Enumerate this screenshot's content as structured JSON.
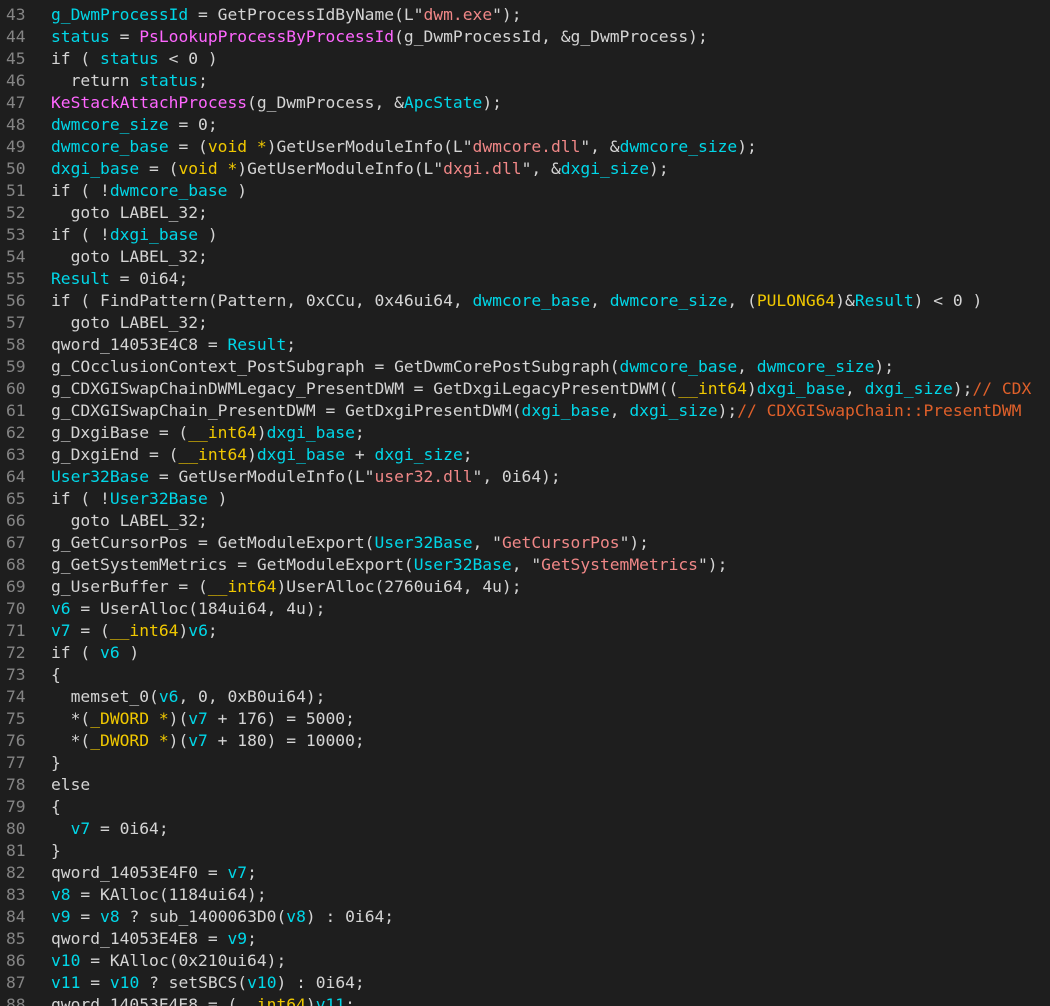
{
  "colors": {
    "background": "#1e1e1e",
    "line_number": "#858585",
    "text": "#d4d4d4",
    "variable": "#00d7e8",
    "string": "#f08787",
    "kernel_function": "#ff66ff",
    "type": "#f0c800",
    "comment": "#e0602a"
  },
  "lines": [
    {
      "n": "43",
      "tokens": [
        [
          "var",
          "g_DwmProcessId"
        ],
        [
          "text",
          " = GetProcessIdByName(L\""
        ],
        [
          "str",
          "dwm.exe"
        ],
        [
          "text",
          "\");"
        ]
      ]
    },
    {
      "n": "44",
      "tokens": [
        [
          "var",
          "status"
        ],
        [
          "text",
          " = "
        ],
        [
          "kfun",
          "PsLookupProcessByProcessId"
        ],
        [
          "text",
          "(g_DwmProcessId, &g_DwmProcess);"
        ]
      ]
    },
    {
      "n": "45",
      "tokens": [
        [
          "text",
          "if ( "
        ],
        [
          "var",
          "status"
        ],
        [
          "text",
          " < 0 )"
        ]
      ]
    },
    {
      "n": "46",
      "tokens": [
        [
          "text",
          "  return "
        ],
        [
          "var",
          "status"
        ],
        [
          "text",
          ";"
        ]
      ]
    },
    {
      "n": "47",
      "tokens": [
        [
          "kfun",
          "KeStackAttachProcess"
        ],
        [
          "text",
          "(g_DwmProcess, &"
        ],
        [
          "var",
          "ApcState"
        ],
        [
          "text",
          ");"
        ]
      ]
    },
    {
      "n": "48",
      "tokens": [
        [
          "var",
          "dwmcore_size"
        ],
        [
          "text",
          " = 0;"
        ]
      ]
    },
    {
      "n": "49",
      "tokens": [
        [
          "var",
          "dwmcore_base"
        ],
        [
          "text",
          " = ("
        ],
        [
          "type",
          "void *"
        ],
        [
          "text",
          ")GetUserModuleInfo(L\""
        ],
        [
          "str",
          "dwmcore.dll"
        ],
        [
          "text",
          "\", &"
        ],
        [
          "var",
          "dwmcore_size"
        ],
        [
          "text",
          ");"
        ]
      ]
    },
    {
      "n": "50",
      "tokens": [
        [
          "var",
          "dxgi_base"
        ],
        [
          "text",
          " = ("
        ],
        [
          "type",
          "void *"
        ],
        [
          "text",
          ")GetUserModuleInfo(L\""
        ],
        [
          "str",
          "dxgi.dll"
        ],
        [
          "text",
          "\", &"
        ],
        [
          "var",
          "dxgi_size"
        ],
        [
          "text",
          ");"
        ]
      ]
    },
    {
      "n": "51",
      "tokens": [
        [
          "text",
          "if ( !"
        ],
        [
          "var",
          "dwmcore_base"
        ],
        [
          "text",
          " )"
        ]
      ]
    },
    {
      "n": "52",
      "tokens": [
        [
          "text",
          "  goto LABEL_32;"
        ]
      ]
    },
    {
      "n": "53",
      "tokens": [
        [
          "text",
          "if ( !"
        ],
        [
          "var",
          "dxgi_base"
        ],
        [
          "text",
          " )"
        ]
      ]
    },
    {
      "n": "54",
      "tokens": [
        [
          "text",
          "  goto LABEL_32;"
        ]
      ]
    },
    {
      "n": "55",
      "tokens": [
        [
          "var",
          "Result"
        ],
        [
          "text",
          " = 0i64;"
        ]
      ]
    },
    {
      "n": "56",
      "tokens": [
        [
          "text",
          "if ( FindPattern(Pattern, 0xCCu, 0x46ui64, "
        ],
        [
          "var",
          "dwmcore_base"
        ],
        [
          "text",
          ", "
        ],
        [
          "var",
          "dwmcore_size"
        ],
        [
          "text",
          ", ("
        ],
        [
          "type",
          "PULONG64"
        ],
        [
          "text",
          ")&"
        ],
        [
          "var",
          "Result"
        ],
        [
          "text",
          ") < 0 )"
        ]
      ]
    },
    {
      "n": "57",
      "tokens": [
        [
          "text",
          "  goto LABEL_32;"
        ]
      ]
    },
    {
      "n": "58",
      "tokens": [
        [
          "text",
          "qword_14053E4C8 = "
        ],
        [
          "var",
          "Result"
        ],
        [
          "text",
          ";"
        ]
      ]
    },
    {
      "n": "59",
      "tokens": [
        [
          "text",
          "g_COcclusionContext_PostSubgraph = GetDwmCorePostSubgraph("
        ],
        [
          "var",
          "dwmcore_base"
        ],
        [
          "text",
          ", "
        ],
        [
          "var",
          "dwmcore_size"
        ],
        [
          "text",
          ");"
        ]
      ]
    },
    {
      "n": "60",
      "tokens": [
        [
          "text",
          "g_CDXGISwapChainDWMLegacy_PresentDWM = GetDxgiLegacyPresentDWM(("
        ],
        [
          "type",
          "__int64"
        ],
        [
          "text",
          ")"
        ],
        [
          "var",
          "dxgi_base"
        ],
        [
          "text",
          ", "
        ],
        [
          "var",
          "dxgi_size"
        ],
        [
          "text",
          ");"
        ],
        [
          "cmt",
          "// CDX"
        ]
      ]
    },
    {
      "n": "61",
      "tokens": [
        [
          "text",
          "g_CDXGISwapChain_PresentDWM = GetDxgiPresentDWM("
        ],
        [
          "var",
          "dxgi_base"
        ],
        [
          "text",
          ", "
        ],
        [
          "var",
          "dxgi_size"
        ],
        [
          "text",
          ");"
        ],
        [
          "cmt",
          "// CDXGISwapChain::PresentDWM"
        ]
      ]
    },
    {
      "n": "62",
      "tokens": [
        [
          "text",
          "g_DxgiBase = ("
        ],
        [
          "type",
          "__int64"
        ],
        [
          "text",
          ")"
        ],
        [
          "var",
          "dxgi_base"
        ],
        [
          "text",
          ";"
        ]
      ]
    },
    {
      "n": "63",
      "tokens": [
        [
          "text",
          "g_DxgiEnd = ("
        ],
        [
          "type",
          "__int64"
        ],
        [
          "text",
          ")"
        ],
        [
          "var",
          "dxgi_base"
        ],
        [
          "text",
          " + "
        ],
        [
          "var",
          "dxgi_size"
        ],
        [
          "text",
          ";"
        ]
      ]
    },
    {
      "n": "64",
      "tokens": [
        [
          "var",
          "User32Base"
        ],
        [
          "text",
          " = GetUserModuleInfo(L\""
        ],
        [
          "str",
          "user32.dll"
        ],
        [
          "text",
          "\", 0i64);"
        ]
      ]
    },
    {
      "n": "65",
      "tokens": [
        [
          "text",
          "if ( !"
        ],
        [
          "var",
          "User32Base"
        ],
        [
          "text",
          " )"
        ]
      ]
    },
    {
      "n": "66",
      "tokens": [
        [
          "text",
          "  goto LABEL_32;"
        ]
      ]
    },
    {
      "n": "67",
      "tokens": [
        [
          "text",
          "g_GetCursorPos = GetModuleExport("
        ],
        [
          "var",
          "User32Base"
        ],
        [
          "text",
          ", \""
        ],
        [
          "str",
          "GetCursorPos"
        ],
        [
          "text",
          "\");"
        ]
      ]
    },
    {
      "n": "68",
      "tokens": [
        [
          "text",
          "g_GetSystemMetrics = GetModuleExport("
        ],
        [
          "var",
          "User32Base"
        ],
        [
          "text",
          ", \""
        ],
        [
          "str",
          "GetSystemMetrics"
        ],
        [
          "text",
          "\");"
        ]
      ]
    },
    {
      "n": "69",
      "tokens": [
        [
          "text",
          "g_UserBuffer = ("
        ],
        [
          "type",
          "__int64"
        ],
        [
          "text",
          ")UserAlloc(2760ui64, 4u);"
        ]
      ]
    },
    {
      "n": "70",
      "tokens": [
        [
          "var",
          "v6"
        ],
        [
          "text",
          " = UserAlloc(184ui64, 4u);"
        ]
      ]
    },
    {
      "n": "71",
      "tokens": [
        [
          "var",
          "v7"
        ],
        [
          "text",
          " = ("
        ],
        [
          "type",
          "__int64"
        ],
        [
          "text",
          ")"
        ],
        [
          "var",
          "v6"
        ],
        [
          "text",
          ";"
        ]
      ]
    },
    {
      "n": "72",
      "tokens": [
        [
          "text",
          "if ( "
        ],
        [
          "var",
          "v6"
        ],
        [
          "text",
          " )"
        ]
      ]
    },
    {
      "n": "73",
      "tokens": [
        [
          "text",
          "{"
        ]
      ]
    },
    {
      "n": "74",
      "tokens": [
        [
          "text",
          "  memset_0("
        ],
        [
          "var",
          "v6"
        ],
        [
          "text",
          ", 0, 0xB0ui64);"
        ]
      ]
    },
    {
      "n": "75",
      "tokens": [
        [
          "text",
          "  *("
        ],
        [
          "type",
          "_DWORD *"
        ],
        [
          "text",
          ")("
        ],
        [
          "var",
          "v7"
        ],
        [
          "text",
          " + 176) = 5000;"
        ]
      ]
    },
    {
      "n": "76",
      "tokens": [
        [
          "text",
          "  *("
        ],
        [
          "type",
          "_DWORD *"
        ],
        [
          "text",
          ")("
        ],
        [
          "var",
          "v7"
        ],
        [
          "text",
          " + 180) = 10000;"
        ]
      ]
    },
    {
      "n": "77",
      "tokens": [
        [
          "text",
          "}"
        ]
      ]
    },
    {
      "n": "78",
      "tokens": [
        [
          "text",
          "else"
        ]
      ]
    },
    {
      "n": "79",
      "tokens": [
        [
          "text",
          "{"
        ]
      ]
    },
    {
      "n": "80",
      "tokens": [
        [
          "text",
          "  "
        ],
        [
          "var",
          "v7"
        ],
        [
          "text",
          " = 0i64;"
        ]
      ]
    },
    {
      "n": "81",
      "tokens": [
        [
          "text",
          "}"
        ]
      ]
    },
    {
      "n": "82",
      "tokens": [
        [
          "text",
          "qword_14053E4F0 = "
        ],
        [
          "var",
          "v7"
        ],
        [
          "text",
          ";"
        ]
      ]
    },
    {
      "n": "83",
      "tokens": [
        [
          "var",
          "v8"
        ],
        [
          "text",
          " = KAlloc(1184ui64);"
        ]
      ]
    },
    {
      "n": "84",
      "tokens": [
        [
          "var",
          "v9"
        ],
        [
          "text",
          " = "
        ],
        [
          "var",
          "v8"
        ],
        [
          "text",
          " ? sub_1400063D0("
        ],
        [
          "var",
          "v8"
        ],
        [
          "text",
          ") : 0i64;"
        ]
      ]
    },
    {
      "n": "85",
      "tokens": [
        [
          "text",
          "qword_14053E4E8 = "
        ],
        [
          "var",
          "v9"
        ],
        [
          "text",
          ";"
        ]
      ]
    },
    {
      "n": "86",
      "tokens": [
        [
          "var",
          "v10"
        ],
        [
          "text",
          " = KAlloc(0x210ui64);"
        ]
      ]
    },
    {
      "n": "87",
      "tokens": [
        [
          "var",
          "v11"
        ],
        [
          "text",
          " = "
        ],
        [
          "var",
          "v10"
        ],
        [
          "text",
          " ? setSBCS("
        ],
        [
          "var",
          "v10"
        ],
        [
          "text",
          ") : 0i64;"
        ]
      ]
    },
    {
      "n": "88",
      "tokens": [
        [
          "text",
          "qword_14053E4E8 = ("
        ],
        [
          "type",
          "__int64"
        ],
        [
          "text",
          ")"
        ],
        [
          "var",
          "v11"
        ],
        [
          "text",
          ";"
        ]
      ]
    }
  ]
}
